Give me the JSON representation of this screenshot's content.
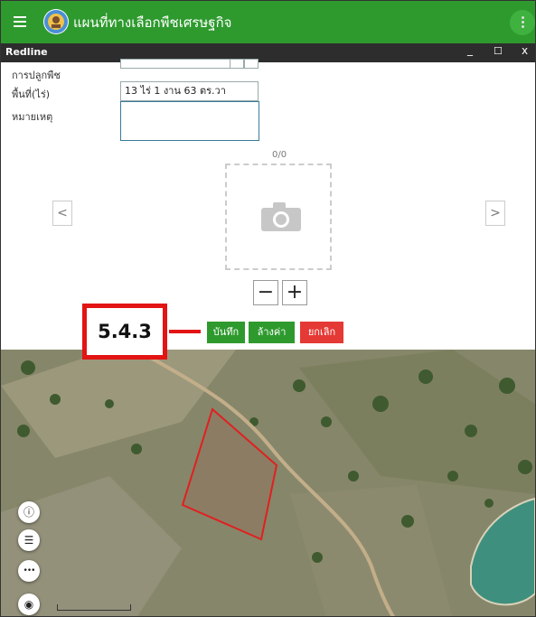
{
  "app": {
    "title": "แผนที่ทางเลือกพืชเศรษฐกิจ"
  },
  "window": {
    "title": "Redline",
    "minimize": "_",
    "maximize": "☐",
    "close": "x"
  },
  "form": {
    "fields": [
      {
        "label": "การปลูกพืช",
        "value": ""
      },
      {
        "label": "พื้นที่(ไร่)",
        "value": "13 ไร่ 1 งาน 63 ตร.วา"
      },
      {
        "label": "หมายเหตุ",
        "value": ""
      }
    ],
    "photo_counter": "0/0",
    "prev_label": "<",
    "next_label": ">",
    "zoom_out_label": "−",
    "zoom_in_label": "+"
  },
  "actions": {
    "save": "บันทึก",
    "clear": "ล้างค่า",
    "cancel": "ยกเลิก"
  },
  "annotation": {
    "label": "5.4.3"
  },
  "map": {
    "controls": [
      {
        "name": "info-icon",
        "glyph": "ⓘ"
      },
      {
        "name": "list-icon",
        "glyph": "☰"
      },
      {
        "name": "more-icon",
        "glyph": "•••"
      },
      {
        "name": "locate-icon",
        "glyph": "◉"
      }
    ]
  },
  "colors": {
    "appbar": "#2e9a2e",
    "window_bar": "#2d2d2d",
    "button": "#2e9a2e",
    "cancel": "#e53935",
    "annotation": "#e31414"
  }
}
